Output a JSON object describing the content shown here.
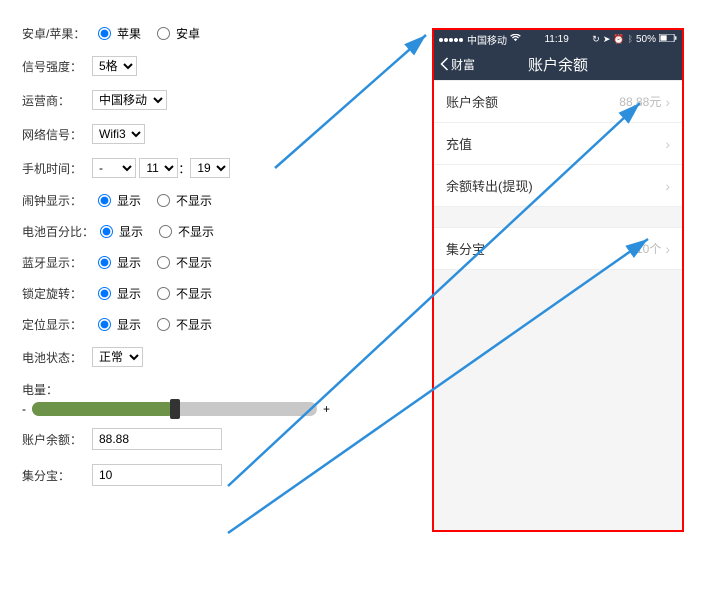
{
  "form": {
    "platform": {
      "label": "安卓/苹果：",
      "opt1": "苹果",
      "opt2": "安卓"
    },
    "signal_strength": {
      "label": "信号强度：",
      "value": "5格"
    },
    "carrier": {
      "label": "运营商：",
      "value": "中国移动"
    },
    "network": {
      "label": "网络信号：",
      "value": "Wifi3"
    },
    "time": {
      "label": "手机时间：",
      "mode": "-",
      "hour": "11",
      "minute": "19",
      "sep": "："
    },
    "alarm": {
      "label": "闹钟显示：",
      "opt1": "显示",
      "opt2": "不显示"
    },
    "battery_pct": {
      "label": "电池百分比：",
      "opt1": "显示",
      "opt2": "不显示"
    },
    "bluetooth": {
      "label": "蓝牙显示：",
      "opt1": "显示",
      "opt2": "不显示"
    },
    "lock_rotation": {
      "label": "锁定旋转：",
      "opt1": "显示",
      "opt2": "不显示"
    },
    "location": {
      "label": "定位显示：",
      "opt1": "显示",
      "opt2": "不显示"
    },
    "battery_state": {
      "label": "电池状态：",
      "value": "正常"
    },
    "power": {
      "label": "电量：",
      "value": 50
    },
    "balance": {
      "label": "账户余额：",
      "value": "88.88"
    },
    "jifenbao": {
      "label": "集分宝：",
      "value": "10"
    }
  },
  "phone": {
    "status": {
      "carrier": "中国移动",
      "time": "11:19",
      "battery_text": "50%"
    },
    "nav": {
      "back": "财富",
      "title": "账户余额"
    },
    "items": [
      {
        "label": "账户余额",
        "value": "88.88元"
      },
      {
        "label": "充值",
        "value": ""
      },
      {
        "label": "余额转出(提现)",
        "value": ""
      }
    ],
    "items2": [
      {
        "label": "集分宝",
        "value": "10个"
      }
    ]
  }
}
